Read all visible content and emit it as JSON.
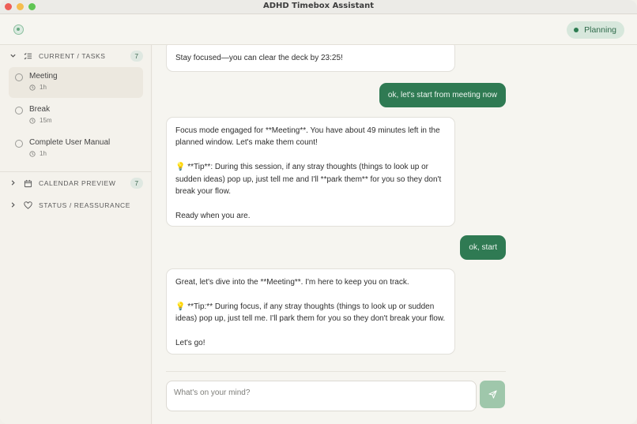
{
  "window": {
    "title": "ADHD Timebox Assistant"
  },
  "header": {
    "status_badge": "Planning"
  },
  "sidebar": {
    "tasks_section": {
      "label": "CURRENT / TASKS",
      "count": "7",
      "items": [
        {
          "name": "Meeting",
          "duration": "1h",
          "active": true
        },
        {
          "name": "Break",
          "duration": "15m",
          "active": false
        },
        {
          "name": "Complete User Manual",
          "duration": "1h",
          "active": false
        }
      ]
    },
    "calendar_section": {
      "label": "CALENDAR PREVIEW",
      "count": "7"
    },
    "status_section": {
      "label": "STATUS / REASSURANCE"
    }
  },
  "chat": {
    "messages": [
      {
        "role": "assistant",
        "paragraphs": [
          "Stay focused—you can clear the deck by 23:25!"
        ]
      },
      {
        "role": "user",
        "text": "ok, let's start from meeting now"
      },
      {
        "role": "assistant",
        "paragraphs": [
          "Focus mode engaged for **Meeting**. You have about 49 minutes left in the planned window. Let's make them count!",
          "💡 **Tip**: During this session, if any stray thoughts (things to look up or sudden ideas) pop up, just tell me and I'll **park them** for you so they don't break your flow.",
          "Ready when you are."
        ]
      },
      {
        "role": "user",
        "text": "ok, start"
      },
      {
        "role": "assistant",
        "paragraphs": [
          "Great, let's dive into the **Meeting**. I'm here to keep you on track.",
          "💡 **Tip:** During focus, if any stray thoughts (things to look up or sudden ideas) pop up, just tell me. I'll park them for you so they don't break your flow.",
          "Let's go!"
        ]
      }
    ],
    "composer": {
      "placeholder": "What's on your mind?"
    }
  },
  "colors": {
    "accent": "#2f7a53",
    "badge_bg": "#d7e7dc",
    "send_button": "#9fc7ab"
  }
}
